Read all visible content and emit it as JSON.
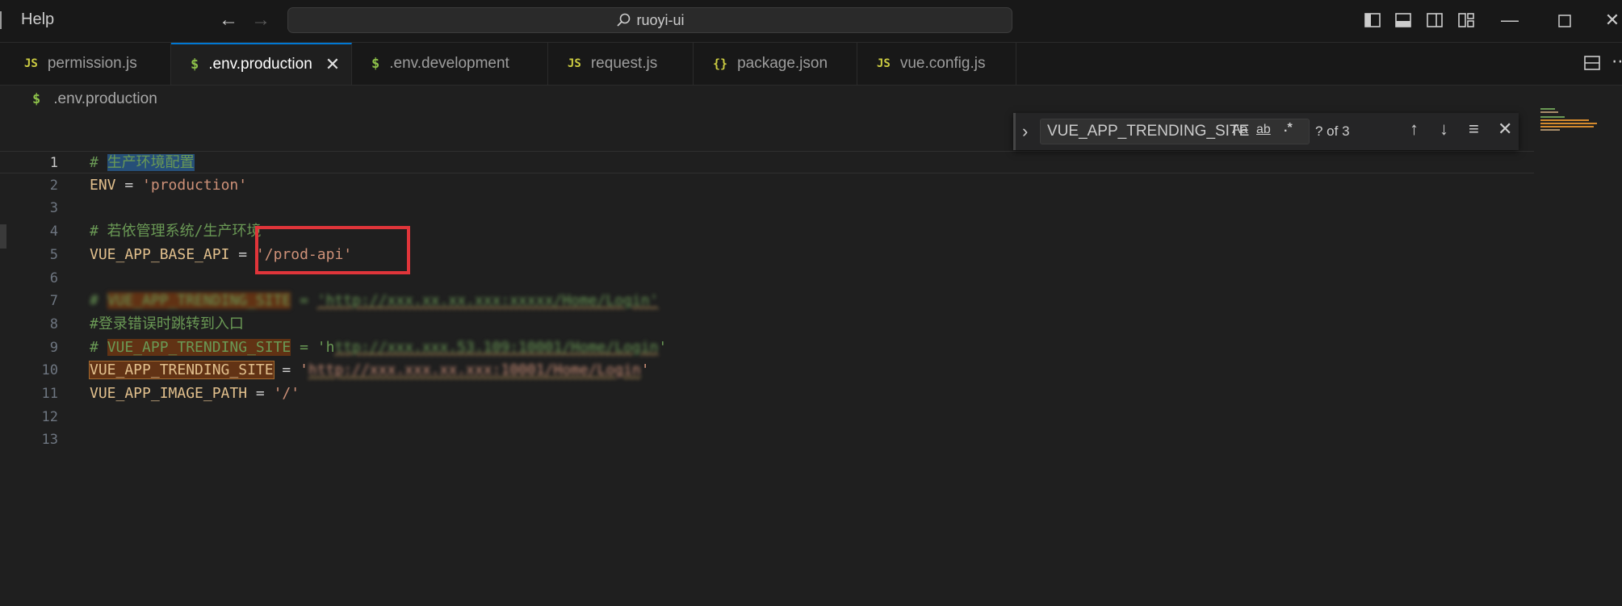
{
  "titlebar": {
    "menu_help": "Help",
    "search_text": "ruoyi-ui",
    "back_icon": "arrow-left-icon",
    "forward_icon": "arrow-right-icon"
  },
  "tabs": [
    {
      "label": "permission.js",
      "icon": "js-file-icon",
      "glyph": "JS",
      "active": false
    },
    {
      "label": ".env.production",
      "icon": "env-file-icon",
      "glyph": "$",
      "active": true
    },
    {
      "label": ".env.development",
      "icon": "env-file-icon",
      "glyph": "$",
      "active": false
    },
    {
      "label": "request.js",
      "icon": "js-file-icon",
      "glyph": "JS",
      "active": false
    },
    {
      "label": "package.json",
      "icon": "json-file-icon",
      "glyph": "{}",
      "active": false
    },
    {
      "label": "vue.config.js",
      "icon": "js-file-icon",
      "glyph": "JS",
      "active": false
    }
  ],
  "breadcrumb": {
    "glyph": "$",
    "file": ".env.production"
  },
  "find": {
    "query": "VUE_APP_TRENDING_SITE",
    "match_case_label": "Aa",
    "whole_word_label": "ab",
    "regex_label": ".*",
    "result_count": "? of 3"
  },
  "editor": {
    "current_line": 1,
    "lines": [
      {
        "n": "1",
        "text": "# 生产环境配置"
      },
      {
        "n": "2",
        "text": "ENV = 'production'"
      },
      {
        "n": "3",
        "text": ""
      },
      {
        "n": "4",
        "text": "# 若依管理系统/生产环境"
      },
      {
        "n": "5",
        "text": "VUE_APP_BASE_API = '/prod-api'"
      },
      {
        "n": "6",
        "text": ""
      },
      {
        "n": "7",
        "text": "# VUE_APP_TRENDING_SITE = 'http://xxx.xx.xx.xxx:xxxxx/Home/Login'"
      },
      {
        "n": "8",
        "text": "#登录错误时跳转到入口"
      },
      {
        "n": "9",
        "text": "# VUE_APP_TRENDING_SITE = 'http://xxx.xxx.53.109:10001/Home/Login'"
      },
      {
        "n": "10",
        "text": "VUE_APP_TRENDING_SITE = 'http://xxx.xxx.xx.xxx:10001/Home/Login'"
      },
      {
        "n": "11",
        "text": "VUE_APP_IMAGE_PATH = '/'"
      },
      {
        "n": "12",
        "text": ""
      },
      {
        "n": "13",
        "text": ""
      }
    ]
  },
  "colors": {
    "accent": "#0078d4",
    "annotation_box": "#e0353a",
    "find_highlight": "#613214"
  }
}
